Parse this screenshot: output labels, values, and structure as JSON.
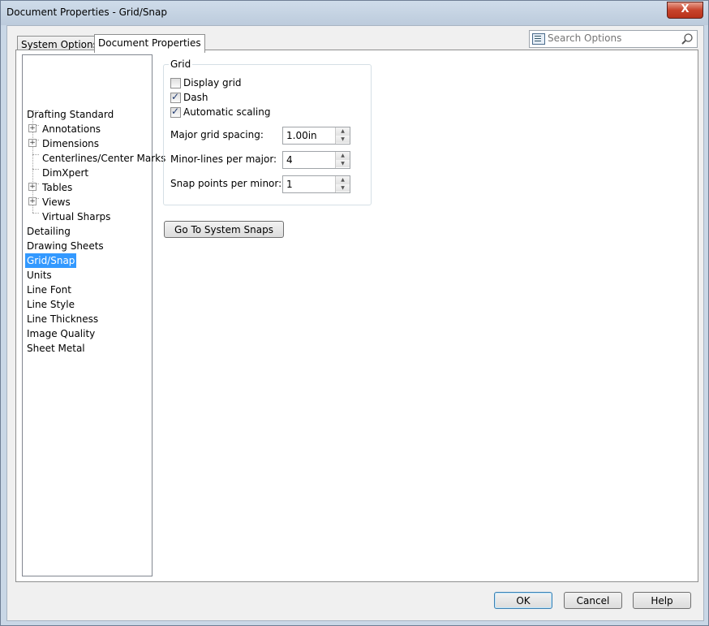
{
  "window": {
    "title": "Document Properties - Grid/Snap",
    "close_glyph": "X"
  },
  "tabs": [
    {
      "label": "System Options"
    },
    {
      "label": "Document Properties"
    }
  ],
  "search": {
    "placeholder": "Search Options",
    "value": ""
  },
  "tree": {
    "items": [
      {
        "label": "Drafting Standard"
      },
      {
        "label": "Annotations",
        "expander": "+"
      },
      {
        "label": "Dimensions",
        "expander": "+"
      },
      {
        "label": "Centerlines/Center Marks"
      },
      {
        "label": "DimXpert"
      },
      {
        "label": "Tables",
        "expander": "+"
      },
      {
        "label": "Views",
        "expander": "+"
      },
      {
        "label": "Virtual Sharps"
      },
      {
        "label": "Detailing"
      },
      {
        "label": "Drawing Sheets"
      },
      {
        "label": "Grid/Snap",
        "selected": true
      },
      {
        "label": "Units"
      },
      {
        "label": "Line Font"
      },
      {
        "label": "Line Style"
      },
      {
        "label": "Line Thickness"
      },
      {
        "label": "Image Quality"
      },
      {
        "label": "Sheet Metal"
      }
    ]
  },
  "grid": {
    "group_label": "Grid",
    "display_grid": {
      "label": "Display grid",
      "checked": false
    },
    "dash": {
      "label": "Dash",
      "checked": true
    },
    "automatic_scaling": {
      "label": "Automatic scaling",
      "checked": true
    },
    "major_spacing": {
      "label": "Major grid spacing:",
      "value": "1.00in"
    },
    "minor_lines": {
      "label": "Minor-lines per major:",
      "value": "4"
    },
    "snap_points": {
      "label": "Snap points per minor:",
      "value": "1"
    }
  },
  "go_to_snaps_label": "Go To System Snaps",
  "buttons": {
    "ok": "OK",
    "cancel": "Cancel",
    "help": "Help"
  },
  "icons": {
    "search_lead": "options-list-icon",
    "search": "magnifier-icon",
    "spin_up": "up-arrow-icon",
    "spin_down": "down-arrow-icon"
  }
}
